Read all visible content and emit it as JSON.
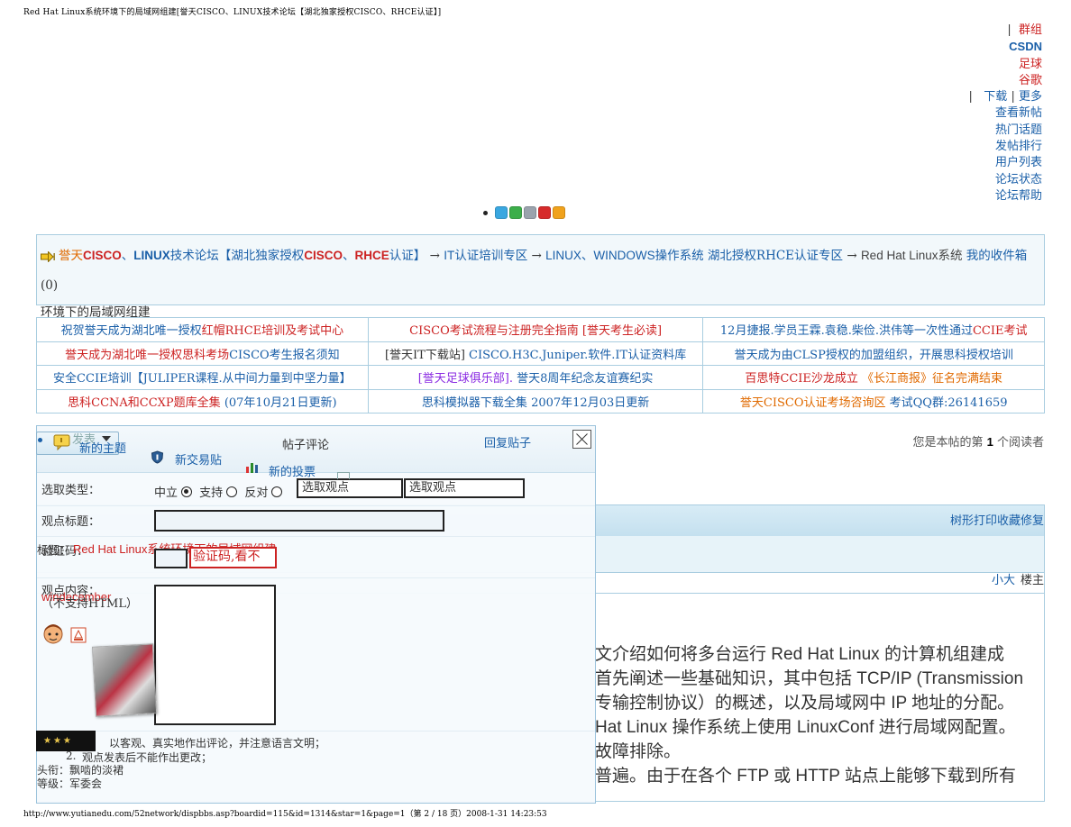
{
  "print": {
    "header": "Red Hat Linux系统环境下的局域网组建[誉天CISCO、LINUX技术论坛【湖北独家授权CISCO、RHCE认证】]",
    "footer": "http://www.yutianedu.com/52network/dispbbs.asp?boardid=115&id=1314&star=1&page=1（第 2 / 18 页）2008-1-31 14:23:53"
  },
  "top_links": {
    "sep1": "|",
    "group": "群组",
    "csdn": "CSDN",
    "football": "足球",
    "google": "谷歌",
    "sep2": "|",
    "download": "下载",
    "sep3": "|",
    "more": "更多",
    "view_new": "查看新帖",
    "hot": "热门话题",
    "rank": "发帖排行",
    "users": "用户列表",
    "status": "论坛状态",
    "help": "论坛帮助"
  },
  "skins": {
    "colors": [
      "#3aa7e0",
      "#3cae4a",
      "#9aa3ad",
      "#d62b2b",
      "#f0a21c"
    ]
  },
  "breadcrumb": {
    "forum_a": "誉天",
    "forum_b": "CISCO",
    "forum_c": "、",
    "forum_d": "LINUX",
    "forum_e": "技术论坛【湖北独家授权",
    "forum_f": "CISCO",
    "forum_g": "、",
    "forum_h": "RHCE",
    "forum_i": "认证】",
    "arrow": "→",
    "it_zone": "IT认证培训专区",
    "os_zone": "LINUX、WINDOWS操作系统",
    "rhce_zone": "湖北授权RHCE认证专区",
    "topic_line1": "Red Hat Linux系统",
    "topic_line2": "环境下的局域网组建",
    "inbox": "我的收件箱",
    "inbox_count": "(0)"
  },
  "announcements": [
    [
      {
        "parts": [
          "祝贺誉天成为湖北唯一授权",
          "红帽RHCE培训及考试中心"
        ]
      },
      {
        "parts": [
          "CISCO考试流程与注册完全指南",
          " [誉天考生必读]"
        ]
      },
      {
        "parts": [
          "12月捷报.学员王霖.袁稳.柴俭.洪伟等一次性通过",
          "CCIE考试"
        ]
      }
    ],
    [
      {
        "parts": [
          "誉天成为湖北唯一授权思科考场",
          "CISCO考生报名须知"
        ]
      },
      {
        "parts": [
          "[誉天IT下载站] ",
          "CISCO.H3C.Juniper.软件.IT认证资料库"
        ]
      },
      {
        "parts": [
          "誉天成为由CLSP授权的加盟组织，开展思科授权培训"
        ]
      }
    ],
    [
      {
        "parts": [
          "安全CCIE培训【JULIPER课程.从中间力量到中坚力量】"
        ]
      },
      {
        "parts": [
          "[誉天足球俱乐部]. ",
          "誉天8周年纪念友谊赛纪实"
        ]
      },
      {
        "parts": [
          "百思特CCIE沙龙成立 ",
          "《长江商报》征名完满结束"
        ]
      }
    ],
    [
      {
        "parts": [
          "思科CCNA和CCXP题库全集 ",
          "(07年10月21日更新)"
        ]
      },
      {
        "parts": [
          "思科模拟器下载全集 ",
          "2007年12月03日更新"
        ]
      },
      {
        "parts": [
          "誉天CISCO认证考场咨询区 ",
          "考试QQ群:26141659"
        ]
      }
    ]
  ],
  "reader": {
    "prefix": "您是本帖的第",
    "count": "1",
    "suffix": "个阅读者"
  },
  "post": {
    "tools": "树形打印收藏修复",
    "user": "小大",
    "floor": "楼主",
    "lines": [
      "文介绍如何将多台运行 Red Hat Linux 的计算机组建成",
      "首先阐述一些基础知识，其中包括 TCP/IP (Transmission",
      "专输控制协议）的概述，以及局域网中 IP 地址的分配。",
      "Hat Linux 操作系统上使用 LinuxConf 进行局域网配置。",
      "故障排除。",
      "普遍。由于在各个 FTP 或 HTTP 站点上能够下载到所有"
    ]
  },
  "reply_panel": {
    "tab_comment": "帖子评论",
    "tab_reply": "回复贴子",
    "new_topic": "新的主题",
    "new_trade": "新交易贴",
    "new_vote": "新的投票",
    "publish_menu": "发表",
    "type_label": "选取类型：",
    "neutral": "中立",
    "support": "支持",
    "oppose": "反对",
    "select_view_1": "选取观点",
    "select_view_2": "选取观点",
    "title_label": "观点标题：",
    "captcha_label": "验证码：",
    "topic_label": "标题：",
    "topic_title": "Red Hat Linux系统环境下的局域网组建",
    "captcha_hint": "验证码,看不",
    "content_label": "观点内容：",
    "content_note": "（不支持HTML）",
    "author": "windecember",
    "rule1": "以客观、真实地作出评论，并注意语言文明；",
    "rule2_num": "2.",
    "rule2": "观点发表后不能作出更改；",
    "title_prefix": "头衔：",
    "title_value": "飘啮的淡裙",
    "level_prefix": "等级：",
    "level_value": "军委会",
    "badge": "★★★"
  }
}
